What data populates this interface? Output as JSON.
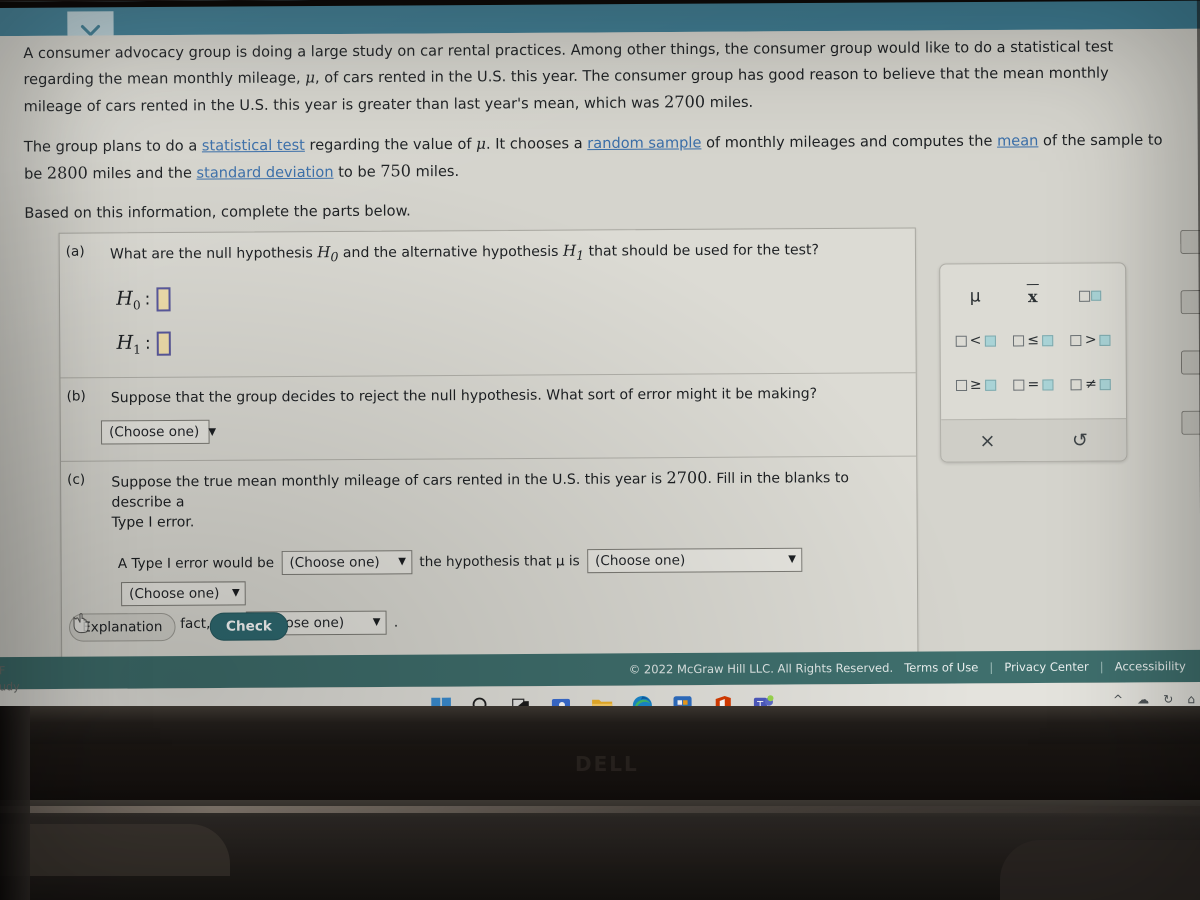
{
  "app": {
    "scroll_toggle_icon": "chevron-down-icon"
  },
  "problem": {
    "p1_a": "A consumer advocacy group is doing a large study on car rental practices. Among other things, the consumer group would like to do a statistical test regarding the mean monthly mileage, ",
    "p1_mu": "μ",
    "p1_b": ", of cars rented in the U.S. this year. The consumer group has good reason to believe that the mean monthly mileage of cars rented in the U.S. this year is greater than last year's mean, which was ",
    "p1_value": "2700",
    "p1_c": " miles.",
    "p2_a": "The group plans to do a ",
    "p2_link1": "statistical test",
    "p2_b": " regarding the value of ",
    "p2_mu": "μ",
    "p2_c": ". It chooses a ",
    "p2_link2": "random sample",
    "p2_d": " of monthly mileages and computes the ",
    "p2_link3": "mean",
    "p2_e": " of the sample to be ",
    "p2_mean": "2800",
    "p2_f": " miles and the ",
    "p2_link4": "standard deviation",
    "p2_g": " to be ",
    "p2_sd": "750",
    "p2_h": " miles.",
    "p3": "Based on this information, complete the parts below."
  },
  "parts": {
    "a": {
      "label": "(a)",
      "text_a": "What are the null hypothesis ",
      "h0_sym": "H",
      "h0_sub": "0",
      "text_b": " and the alternative hypothesis ",
      "h1_sym": "H",
      "h1_sub": "1",
      "text_c": " that should be used for the test?",
      "row0_label": "H",
      "row0_sub": "0",
      "row0_colon": ":",
      "row1_label": "H",
      "row1_sub": "1",
      "row1_colon": ":"
    },
    "b": {
      "label": "(b)",
      "text": "Suppose that the group decides to reject the null hypothesis. What sort of error might it be making?",
      "select_value": "(Choose one)"
    },
    "c": {
      "label": "(c)",
      "text_line1": "Suppose the true mean monthly mileage of cars rented in the U.S. this year is ",
      "text_value": "2700",
      "text_line1b": ". Fill in the blanks to describe a",
      "text_line2": "Type I error.",
      "fill_a": "A Type I error would be",
      "sel1": "(Choose one)",
      "fill_b": "the hypothesis that μ is",
      "sel2": "(Choose one)",
      "sel3": "(Choose one)",
      "fill_c": "when, in fact, μ is",
      "sel4": "(Choose one)",
      "fill_d": "."
    }
  },
  "keypad": {
    "keys": [
      [
        {
          "name": "mu-key",
          "label": "μ"
        },
        {
          "name": "x-bar-key",
          "label": "x"
        },
        {
          "name": "power-key",
          "label": "□^□"
        }
      ],
      [
        {
          "name": "less-than-key",
          "label": "□<□",
          "op": "<"
        },
        {
          "name": "less-equal-key",
          "label": "□≤□",
          "op": "≤"
        },
        {
          "name": "greater-than-key",
          "label": "□>□",
          "op": ">"
        }
      ],
      [
        {
          "name": "greater-equal-key",
          "label": "□≥□",
          "op": "≥"
        },
        {
          "name": "equals-key",
          "label": "□=□",
          "op": "="
        },
        {
          "name": "not-equal-key",
          "label": "□≠□",
          "op": "≠"
        }
      ]
    ],
    "clear_label": "×",
    "undo_label": "↺"
  },
  "actions": {
    "explanation": "Explanation",
    "check": "Check"
  },
  "footer": {
    "copyright": "© 2022 McGraw Hill LLC. All Rights Reserved.",
    "terms": "Terms of Use",
    "separator": "|",
    "privacy": "Privacy Center",
    "accessibility": "Accessibility"
  },
  "desktop": {
    "left_label_1": "F",
    "left_label_2": "udy",
    "taskbar_icons": [
      "windows-start-icon",
      "search-icon",
      "task-view-icon",
      "chat-icon",
      "file-explorer-icon",
      "edge-browser-icon",
      "microsoft-store-icon",
      "office-icon",
      "teams-icon"
    ],
    "tray_icons": [
      "chevron-up-icon",
      "cloud-icon",
      "sync-icon",
      "wifi-icon"
    ]
  },
  "laptop": {
    "brand": "DELL"
  },
  "colors": {
    "app_header_teal": "#3f7d93",
    "footer_teal": "#3f6f6d",
    "check_button": "#2f6b72",
    "link_blue": "#3a6ea8",
    "input_fill": "#f3e1ad",
    "input_border": "#5a5aa0",
    "keypad_fill": "#a9d3d6"
  }
}
